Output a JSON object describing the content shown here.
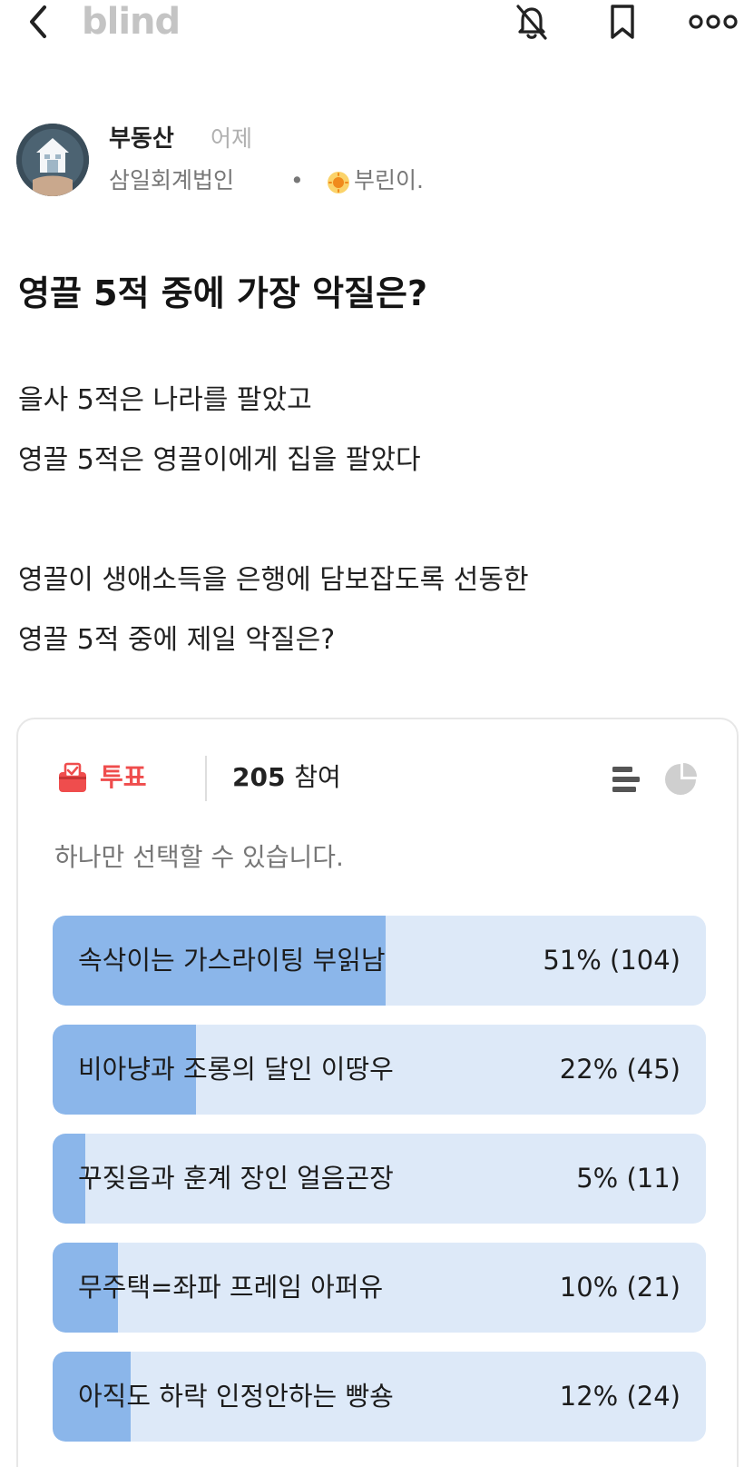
{
  "app": {
    "logo_text": "blind"
  },
  "header": {
    "icons": [
      "chevron-left-icon",
      "bell-off-icon",
      "bookmark-icon",
      "more-icon"
    ]
  },
  "author": {
    "name": "부동산",
    "time": "어제",
    "company": "삼일회계법인",
    "separator": "•",
    "badge_label": "부린이.",
    "badge_color": "#f5a623"
  },
  "post": {
    "title": "영끌 5적 중에 가장 악질은?",
    "body_lines": [
      "을사 5적은 나라를 팔았고",
      "영끌 5적은 영끌이에게 집을 팔았다",
      "",
      "영끌이 생애소득을 은행에 담보잡도록 선동한",
      "영끌 5적 중에 제일 악질은?"
    ]
  },
  "poll": {
    "label": "투표",
    "accent_color": "#ef4d4d",
    "participants": "205",
    "participants_suffix": "참여",
    "hint": "하나만 선택할 수 있습니다.",
    "bar_color": "#8bb6ea",
    "track_color": "#dde9f8",
    "options": [
      {
        "label": "속삭이는 가스라이팅 부읽남",
        "percent": 51,
        "result": "51% (104)"
      },
      {
        "label": "비아냥과 조롱의 달인 이땅우",
        "percent": 22,
        "result": "22% (45)"
      },
      {
        "label": "꾸짖음과 훈계 장인 얼음곤장",
        "percent": 5,
        "result": "5% (11)"
      },
      {
        "label": "무주택=좌파 프레임 아퍼유",
        "percent": 10,
        "result": "10% (21)"
      },
      {
        "label": "아직도 하락 인정안하는 빵숑",
        "percent": 12,
        "result": "12% (24)"
      }
    ]
  }
}
